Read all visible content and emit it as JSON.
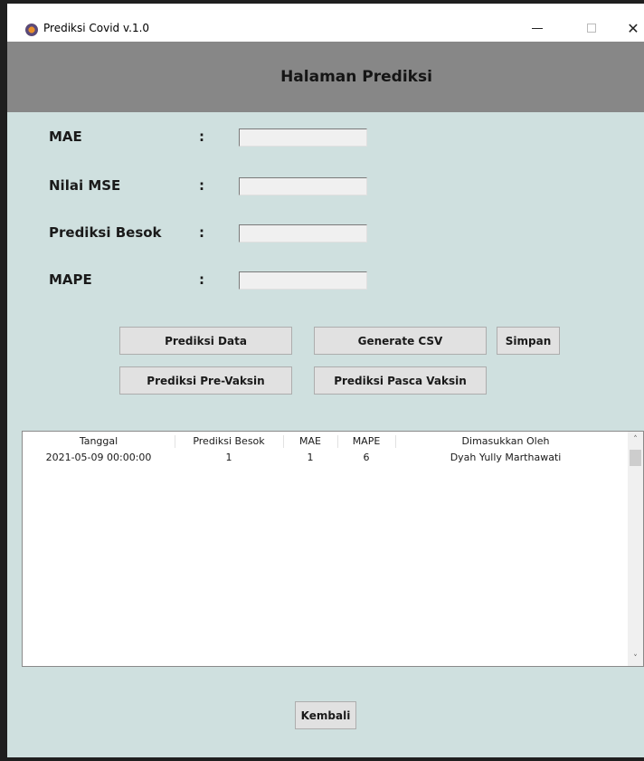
{
  "window": {
    "title": "Prediksi Covid v.1.0",
    "minimize": "–",
    "close": "✕"
  },
  "header": {
    "title": "Halaman Prediksi"
  },
  "fields": [
    {
      "label": "MAE",
      "colon": ":",
      "value": ""
    },
    {
      "label": "Nilai MSE",
      "colon": ":",
      "value": ""
    },
    {
      "label": "Prediksi Besok",
      "colon": ":",
      "value": ""
    },
    {
      "label": "MAPE",
      "colon": ":",
      "value": ""
    }
  ],
  "buttons": {
    "prediksi_data": "Prediksi Data",
    "generate_csv": "Generate CSV",
    "simpan": "Simpan",
    "prediksi_pre_vaksin": "Prediksi Pre-Vaksin",
    "prediksi_pasca_vaksin": "Prediksi Pasca Vaksin",
    "kembali": "Kembali"
  },
  "table": {
    "columns": [
      "Tanggal",
      "Prediksi Besok",
      "MAE",
      "MAPE",
      "Dimasukkan Oleh"
    ],
    "rows": [
      [
        "2021-05-09 00:00:00",
        "1",
        "1",
        "6",
        "Dyah Yully Marthawati"
      ]
    ]
  },
  "scrollbar": {
    "up": "˄",
    "down": "˅"
  },
  "colors": {
    "background": "#cfe0df",
    "header": "#878787",
    "button": "#e1e1e1"
  },
  "icons": {
    "app": "app-logo-icon",
    "minimize": "minimize-icon",
    "maximize": "maximize-icon",
    "close": "close-icon"
  }
}
